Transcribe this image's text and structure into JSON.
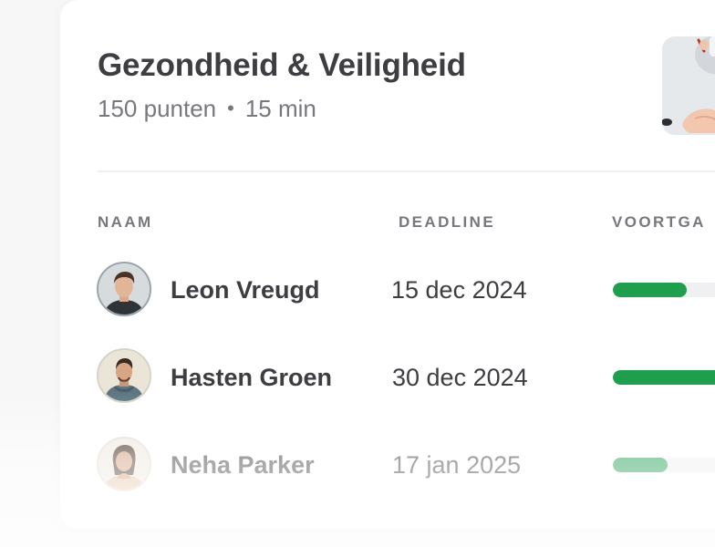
{
  "course": {
    "title": "Gezondheid & Veiligheid",
    "points": "150 punten",
    "separator": "•",
    "duration": "15 min",
    "thumbnail_icon": "hand-sanitizer-photo"
  },
  "table": {
    "columns": {
      "name": "NAAM",
      "deadline": "DEADLINE",
      "progress": "VOORTGA"
    },
    "rows": [
      {
        "name": "Leon Vreugd",
        "deadline": "15 dec 2024",
        "progress": 0.58,
        "avatar_icon": "person-avatar"
      },
      {
        "name": "Hasten Groen",
        "deadline": "30 dec 2024",
        "progress": 0.85,
        "avatar_icon": "person-avatar"
      },
      {
        "name": "Neha Parker",
        "deadline": "17 jan 2025",
        "progress": 0.43,
        "avatar_icon": "person-avatar"
      }
    ]
  },
  "colors": {
    "progress_fill": "#1f9e4e",
    "progress_track": "#f0f0f2",
    "text_primary": "#3d3d42",
    "text_secondary": "#77777d"
  }
}
